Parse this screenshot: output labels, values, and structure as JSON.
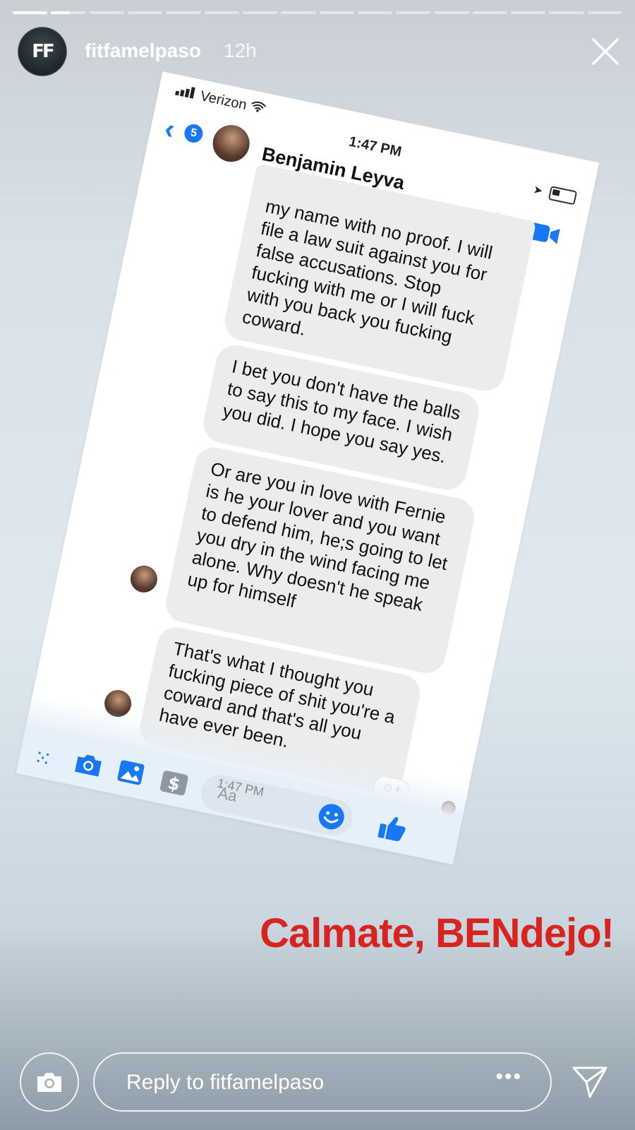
{
  "story": {
    "segments": 16,
    "active_index": 1,
    "progress": [
      1,
      0.55,
      0,
      0,
      0,
      0,
      0,
      0,
      0,
      0,
      0,
      0,
      0,
      0,
      0,
      0
    ],
    "username": "fitfamelpaso",
    "time_ago": "12h",
    "avatar_logo": "FF",
    "close_icon": "close-icon"
  },
  "screenshot": {
    "carrier": "Verizon",
    "clock": "1:47 PM",
    "back_badge": "5",
    "contact_name": "Benjamin Leyva",
    "messages": [
      "my name with no proof. I will file a law suit against you for false accusations. Stop fucking with me or I will fuck with you back you fucking coward.",
      "I bet you don't have the balls to say this to my face. I wish you did. I hope you say yes.",
      "Or are you in love with Fernie is he your lover and you want to defend him, he;s going to let you dry in the wind facing me alone. Why doesn't he speak up for himself",
      "That's what I thought you fucking piece of shit you're a coward and that's all you have ever been."
    ],
    "timestamp": "1:47 PM",
    "composer_placeholder": "Aa",
    "accent": "#1877f2"
  },
  "caption": {
    "text": "Calmate, BENdejo!",
    "color": "#d8231f"
  },
  "footer": {
    "reply_placeholder": "Reply to fitfamelpaso",
    "more": "•••"
  }
}
